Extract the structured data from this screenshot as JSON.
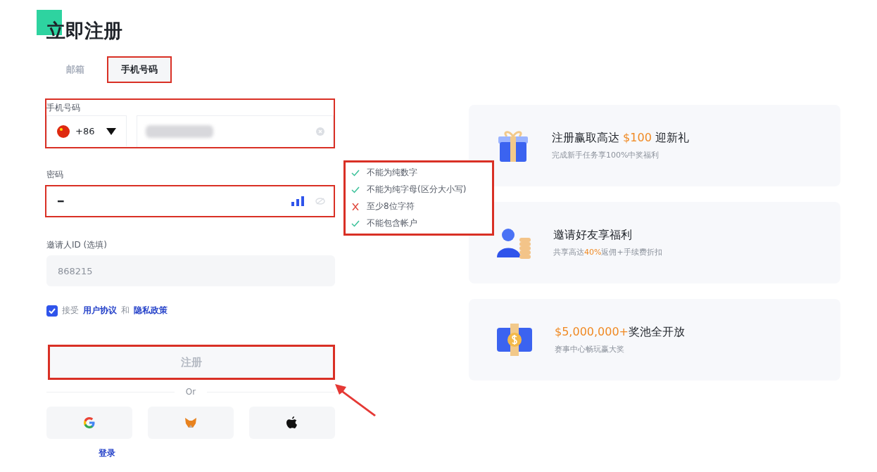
{
  "title": "立即注册",
  "tabs": [
    {
      "label": "邮箱",
      "selected": false
    },
    {
      "label": "手机号码",
      "selected": true
    }
  ],
  "phone": {
    "label": "手机号码",
    "country_code": "+86"
  },
  "password": {
    "label": "密码",
    "value": "━"
  },
  "password_rules": [
    {
      "text": "不能为纯数字",
      "passed": true
    },
    {
      "text": "不能为纯字母(区分大小写)",
      "passed": true
    },
    {
      "text": "至少8位字符",
      "passed": false
    },
    {
      "text": "不能包含帐户",
      "passed": true
    }
  ],
  "invite": {
    "label": "邀请人ID (选填)",
    "value": "868215"
  },
  "agreement": {
    "checked": true,
    "prefix": "接受",
    "terms_link": "用户协议",
    "joiner": "和",
    "privacy_link": "隐私政策"
  },
  "submit": {
    "label": "注册",
    "disabled": true
  },
  "divider": "Or",
  "social_buttons": [
    {
      "kind": "google"
    },
    {
      "kind": "fox"
    },
    {
      "kind": "apple"
    }
  ],
  "login_link": "登录",
  "promos": [
    {
      "title": [
        {
          "text": "注册赢取高达 ",
          "highlight": false
        },
        {
          "text": "$100",
          "highlight": true
        },
        {
          "text": " 迎新礼",
          "highlight": false
        }
      ],
      "subtitle": [
        {
          "text": "完成新手任务享100%中奖福利",
          "highlight": false
        }
      ]
    },
    {
      "title": [
        {
          "text": "邀请好友享福利",
          "highlight": false
        }
      ],
      "subtitle": [
        {
          "text": "共享高达",
          "highlight": false
        },
        {
          "text": "40%",
          "highlight": true
        },
        {
          "text": "返佣+手续费折扣",
          "highlight": false
        }
      ]
    },
    {
      "title": [
        {
          "text": "$5,000,000+",
          "highlight": true
        },
        {
          "text": "奖池全开放",
          "highlight": false
        }
      ],
      "subtitle": [
        {
          "text": "赛事中心畅玩赢大奖",
          "highlight": false
        }
      ]
    }
  ]
}
